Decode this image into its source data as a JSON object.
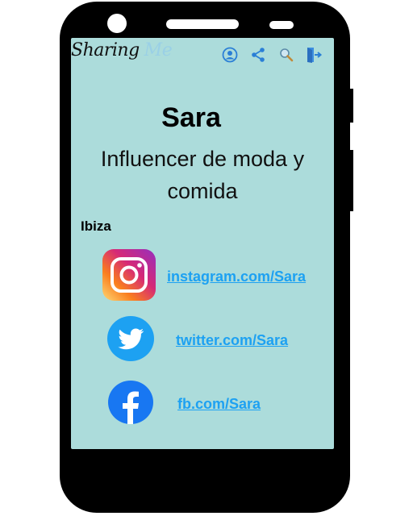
{
  "header": {
    "brand_part1": "Sharing",
    "brand_part2": "Me",
    "icons": [
      "profile-icon",
      "share-icon",
      "search-icon",
      "logout-icon"
    ]
  },
  "profile": {
    "name": "Sara",
    "bio_line1": "Influencer de moda y",
    "bio_line2": "comida",
    "location": "Ibiza"
  },
  "social_links": [
    {
      "network": "instagram",
      "icon": "instagram-icon",
      "label": "instagram.com/Sara"
    },
    {
      "network": "twitter",
      "icon": "twitter-icon",
      "label": "twitter.com/Sara"
    },
    {
      "network": "facebook",
      "icon": "facebook-icon",
      "label": "fb.com/Sara"
    }
  ],
  "colors": {
    "screen_bg": "#acdcdb",
    "link": "#1da1f2",
    "toolbar_icon": "#2a7fd6"
  }
}
